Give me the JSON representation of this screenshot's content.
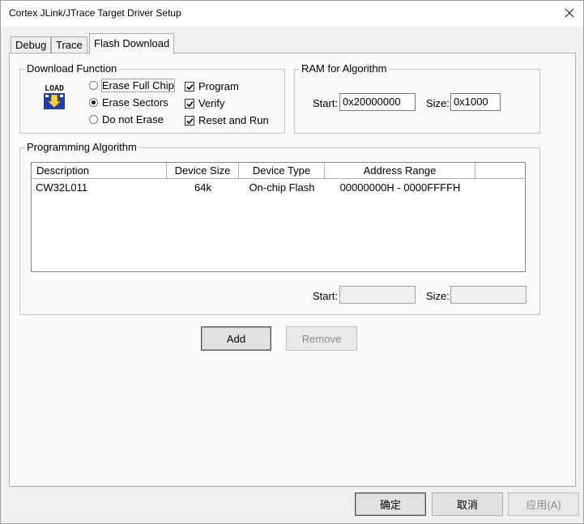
{
  "window": {
    "title": "Cortex JLink/JTrace Target Driver Setup"
  },
  "tabs": [
    {
      "label": "Debug",
      "active": false
    },
    {
      "label": "Trace",
      "active": false
    },
    {
      "label": "Flash Download",
      "active": true
    }
  ],
  "download_function": {
    "title": "Download Function",
    "icon": "load-icon",
    "icon_text": "LOAD",
    "radios": [
      {
        "label": "Erase Full Chip",
        "checked": false
      },
      {
        "label": "Erase Sectors",
        "checked": true
      },
      {
        "label": "Do not Erase",
        "checked": false
      }
    ],
    "checks": [
      {
        "label": "Program",
        "checked": true
      },
      {
        "label": "Verify",
        "checked": true
      },
      {
        "label": "Reset and Run",
        "checked": true
      }
    ]
  },
  "ram": {
    "title": "RAM for Algorithm",
    "start_label": "Start:",
    "start_value": "0x20000000",
    "size_label": "Size:",
    "size_value": "0x1000"
  },
  "algorithm": {
    "title": "Programming Algorithm",
    "columns": [
      "Description",
      "Device Size",
      "Device Type",
      "Address Range"
    ],
    "rows": [
      {
        "description": "CW32L011",
        "size": "64k",
        "type": "On-chip Flash",
        "range": "00000000H - 0000FFFFH"
      }
    ],
    "start_label": "Start:",
    "start_value": "",
    "size_label": "Size:",
    "size_value": ""
  },
  "buttons": {
    "add": "Add",
    "remove": "Remove",
    "ok": "确定",
    "cancel": "取消",
    "apply": "应用(A)"
  },
  "colors": {
    "selection": "#000000",
    "disabled_text": "#8a8a8a"
  }
}
